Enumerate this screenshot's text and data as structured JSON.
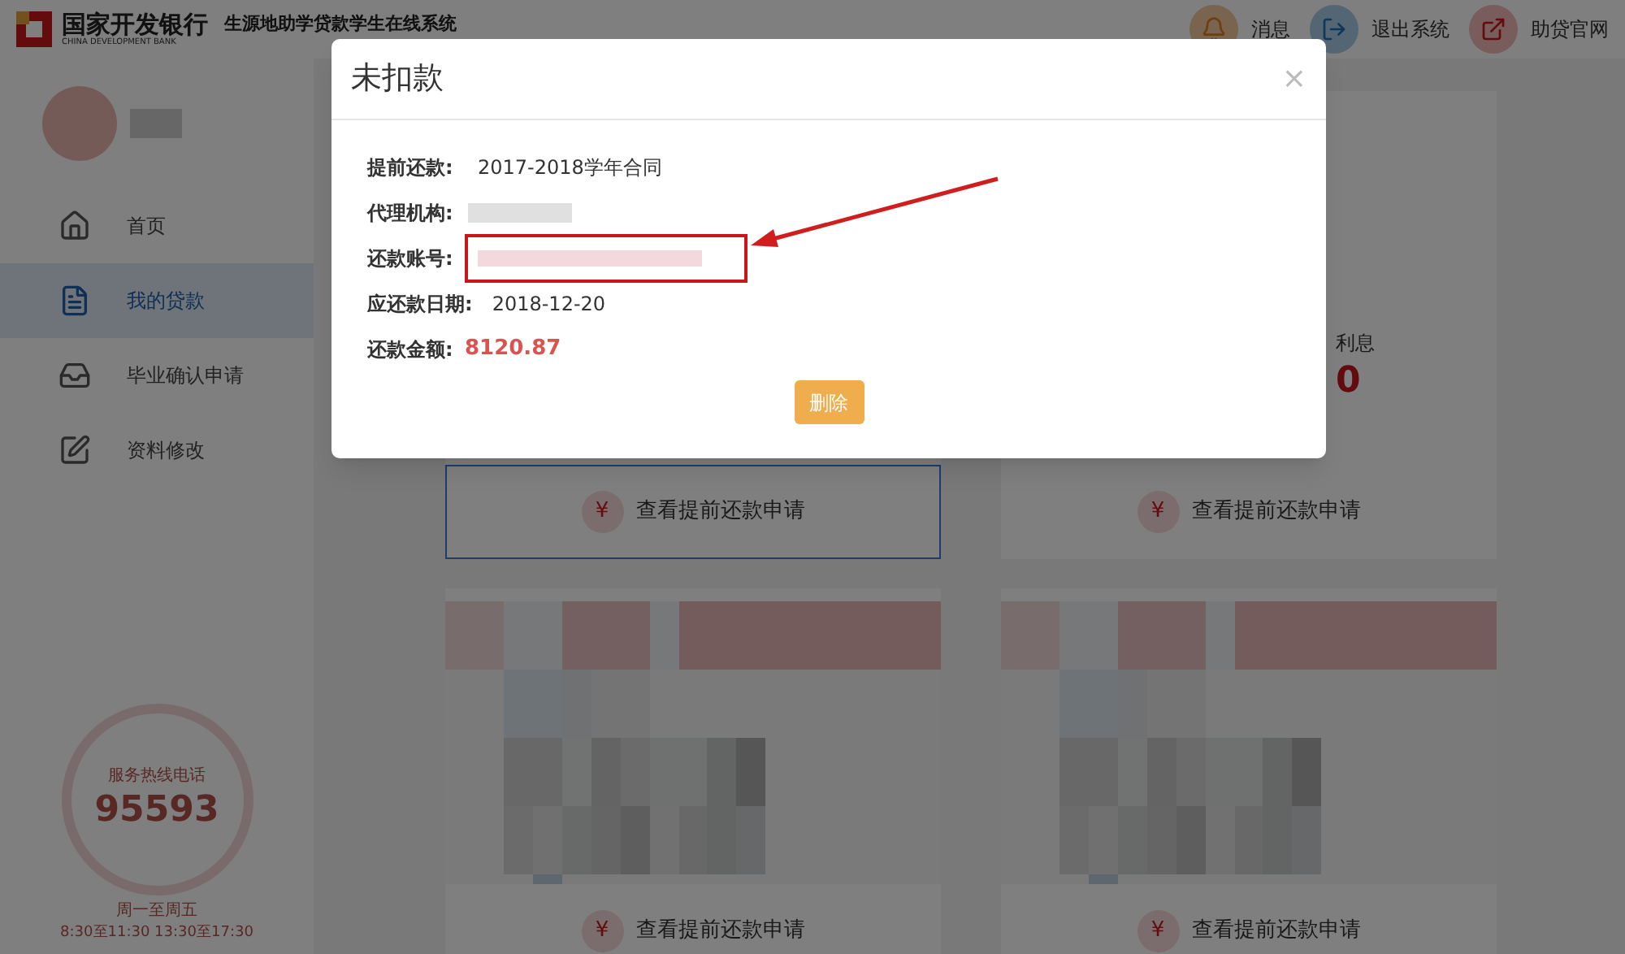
{
  "header": {
    "bank_name": "国家开发银行",
    "bank_name_en": "CHINA DEVELOPMENT BANK",
    "system_title": "生源地助学贷款学生在线系统",
    "nav": [
      {
        "kind": "bell",
        "label": "消息"
      },
      {
        "kind": "logout",
        "label": "退出系统"
      },
      {
        "kind": "external",
        "label": "助贷官网"
      }
    ]
  },
  "sidebar": {
    "items": [
      {
        "kind": "home",
        "label": "首页",
        "selected": false
      },
      {
        "kind": "list",
        "label": "我的贷款",
        "selected": true
      },
      {
        "kind": "inbox",
        "label": "毕业确认申请",
        "selected": false
      },
      {
        "kind": "edit",
        "label": "资料修改",
        "selected": false
      }
    ],
    "hotline": {
      "title": "服务热线电话",
      "number": "95593",
      "days": "周一至周五",
      "hours": "8:30至11:30 13:30至17:30"
    }
  },
  "stat": {
    "label": "利息",
    "value": "0"
  },
  "cards": [
    {
      "icon": "¥",
      "button": "查看提前还款申请",
      "focused": true
    },
    {
      "icon": "¥",
      "button": "查看提前还款申请",
      "focused": false
    },
    {
      "icon": "¥",
      "button": "查看提前还款申请",
      "focused": false
    },
    {
      "icon": "¥",
      "button": "查看提前还款申请",
      "focused": false
    }
  ],
  "modal": {
    "title": "未扣款",
    "close": "×",
    "fields": [
      {
        "kind": "text",
        "label": "提前还款:",
        "value": "2017-2018学年合同"
      },
      {
        "kind": "redacted",
        "label": "代理机构:",
        "highlighted": false
      },
      {
        "kind": "redacted",
        "label": "还款账号:",
        "highlighted": true
      },
      {
        "kind": "text",
        "label": "应还款日期:",
        "value": "2018-12-20"
      },
      {
        "kind": "amount",
        "label": "还款金额:",
        "value": "8120.87"
      }
    ],
    "button": "删除"
  }
}
